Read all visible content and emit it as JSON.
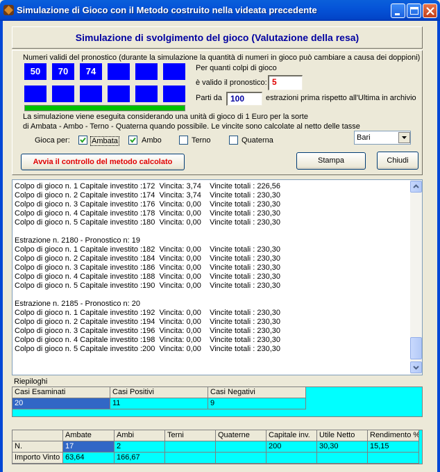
{
  "window": {
    "title": "Simulazione di Gioco con il Metodo costruito nella videata precedente"
  },
  "header": {
    "title": "Simulazione di svolgimento del gioco (Valutazione della resa)"
  },
  "pronostico": {
    "label": "Numeri validi del pronostico (durante la simulazione la quantità di numeri in gioco può cambiare a causa dei doppioni)",
    "numbers": [
      "50",
      "70",
      "74",
      "",
      "",
      "",
      "",
      "",
      "",
      "",
      "",
      ""
    ],
    "colpi_label_1": "Per quanti colpi di gioco",
    "colpi_label_2": "è valido il pronostico:",
    "colpi_value": "5",
    "parti_da_label": "Parti da",
    "parti_da_value": "100",
    "estrazioni_label": "estrazioni prima rispetto all'Ultima in archivio",
    "progress": 1.0
  },
  "info": {
    "line1": "La simulazione viene eseguita considerando una unità di gioco di 1 Euro per la sorte",
    "line2": "di Ambata - Ambo - Terno - Quaterna quando possibile. Le vincite sono calcolate  al netto delle tasse"
  },
  "gioca": {
    "label": "Gioca per:",
    "options": [
      {
        "label": "Ambata",
        "checked": true
      },
      {
        "label": "Ambo",
        "checked": true
      },
      {
        "label": "Terno",
        "checked": false
      },
      {
        "label": "Quaterna",
        "checked": false
      }
    ],
    "ruota": "Bari"
  },
  "buttons": {
    "avvia": "Avvia il controllo del metodo  calcolato",
    "stampa": "Stampa",
    "chiudi": "Chiudi"
  },
  "log": [
    "Colpo di gioco n. 1 Capitale investito :172  Vincita: 3,74    Vincite totali : 226,56",
    "Colpo di gioco n. 2 Capitale investito :174  Vincita: 3,74    Vincite totali : 230,30",
    "Colpo di gioco n. 3 Capitale investito :176  Vincita: 0,00    Vincite totali : 230,30",
    "Colpo di gioco n. 4 Capitale investito :178  Vincita: 0,00    Vincite totali : 230,30",
    "Colpo di gioco n. 5 Capitale investito :180  Vincita: 0,00    Vincite totali : 230,30",
    "",
    "Estrazione n. 2180 - Pronostico n: 19",
    "Colpo di gioco n. 1 Capitale investito :182  Vincita: 0,00    Vincite totali : 230,30",
    "Colpo di gioco n. 2 Capitale investito :184  Vincita: 0,00    Vincite totali : 230,30",
    "Colpo di gioco n. 3 Capitale investito :186  Vincita: 0,00    Vincite totali : 230,30",
    "Colpo di gioco n. 4 Capitale investito :188  Vincita: 0,00    Vincite totali : 230,30",
    "Colpo di gioco n. 5 Capitale investito :190  Vincita: 0,00    Vincite totali : 230,30",
    "",
    "Estrazione n. 2185 - Pronostico n: 20",
    "Colpo di gioco n. 1 Capitale investito :192  Vincita: 0,00    Vincite totali : 230,30",
    "Colpo di gioco n. 2 Capitale investito :194  Vincita: 0,00    Vincite totali : 230,30",
    "Colpo di gioco n. 3 Capitale investito :196  Vincita: 0,00    Vincite totali : 230,30",
    "Colpo di gioco n. 4 Capitale investito :198  Vincita: 0,00    Vincite totali : 230,30",
    "Colpo di gioco n. 5 Capitale investito :200  Vincita: 0,00    Vincite totali : 230,30"
  ],
  "riepiloghi": {
    "label": "Riepiloghi",
    "headers": [
      "Casi Esaminati",
      "Casi Positivi",
      "Casi Negativi"
    ],
    "values": [
      "20",
      "11",
      "9"
    ]
  },
  "results": {
    "headers": [
      "",
      "Ambate",
      "Ambi",
      "Terni",
      "Quaterne",
      "Capitale inv.",
      "Utile Netto",
      "Rendimento %"
    ],
    "rows": [
      [
        "N.",
        "17",
        "2",
        "",
        "",
        "200",
        "30,30",
        "15,15"
      ],
      [
        "Importo Vinto",
        "63,64",
        "166,67",
        "",
        "",
        "",
        "",
        ""
      ]
    ]
  },
  "colors": {
    "titlebar": "#0554D8",
    "number_box": "#0000FF",
    "grid_bg": "#00FFFF",
    "selection": "#3167C6",
    "progress": "#00C000",
    "avvia_text": "#E00000",
    "header_text": "#0000A0"
  }
}
